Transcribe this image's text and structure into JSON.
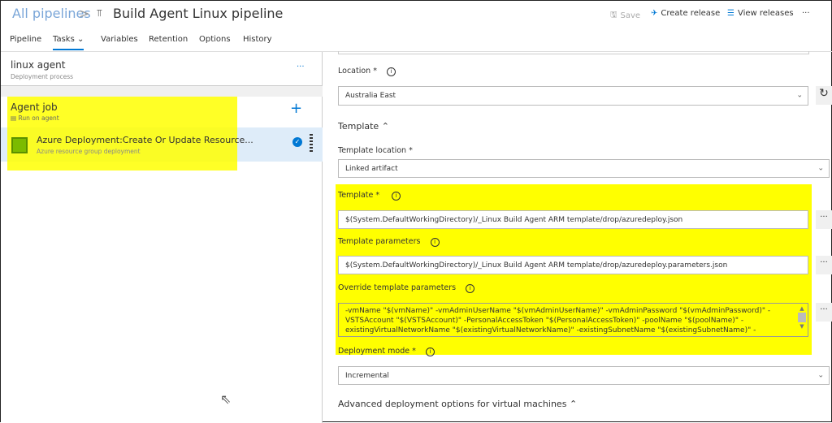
{
  "header": {
    "breadcrumb": "All pipelines",
    "separator": ">",
    "title": "Build Agent Linux pipeline",
    "save": "Save",
    "create_release": "Create release",
    "view_releases": "View releases",
    "more": "···"
  },
  "tabs": [
    {
      "label": "Pipeline"
    },
    {
      "label": "Tasks"
    },
    {
      "label": "Variables"
    },
    {
      "label": "Retention"
    },
    {
      "label": "Options"
    },
    {
      "label": "History"
    }
  ],
  "process": {
    "name": "linux agent",
    "subtitle": "Deployment process",
    "more": "···"
  },
  "agent_job": {
    "title": "Agent job",
    "subtitle": "Run on agent",
    "add": "+"
  },
  "task": {
    "title": "Azure Deployment:Create Or Update Resource...",
    "subtitle": "Azure resource group deployment"
  },
  "form": {
    "location_label": "Location *",
    "location_value": "Australia East",
    "template_section": "Template",
    "template_location_label": "Template location *",
    "template_location_value": "Linked artifact",
    "template_label": "Template *",
    "template_value": "$(System.DefaultWorkingDirectory)/_Linux Build Agent ARM template/drop/azuredeploy.json",
    "params_label": "Template parameters",
    "params_value": "$(System.DefaultWorkingDirectory)/_Linux Build Agent ARM template/drop/azuredeploy.parameters.json",
    "override_label": "Override template parameters",
    "override_value": "-vmName \"$(vmName)\"  -vmAdminUserName \"$(vmAdminUserName)\"  -vmAdminPassword \"$(vmAdminPassword)\" -VSTSAccount \"$(VSTSAccount)\" -PersonalAccessToken \"$(PersonalAccessToken)\" -poolName \"$(poolName)\"  -existingVirtualNetworkName \"$(existingVirtualNetworkName)\" -existingSubnetName \"$(existingSubnetName)\" -",
    "mode_label": "Deployment mode *",
    "mode_value": "Incremental",
    "advanced": "Advanced deployment options for virtual machines",
    "ellipsis": "···"
  },
  "colors": {
    "highlight": "#ffff00",
    "accent": "#0078d4",
    "selected_row": "#deecf9"
  }
}
